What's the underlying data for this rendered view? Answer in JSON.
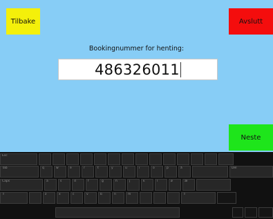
{
  "buttons": {
    "back": "Tilbake",
    "exit": "Avslutt",
    "next": "Neste"
  },
  "prompt": "Bookingnummer for henting:",
  "booking_field": {
    "value": "486326011"
  },
  "keyboard": {
    "rows": [
      [
        "Esc",
        "",
        "",
        "",
        "",
        "",
        "",
        "",
        "",
        "",
        "",
        "",
        "",
        "",
        ""
      ],
      [
        "Tab",
        "q",
        "w",
        "e",
        "r",
        "t",
        "y",
        "u",
        "i",
        "o",
        "p",
        "å",
        "",
        "Del"
      ],
      [
        "Caps",
        "a",
        "s",
        "d",
        "f",
        "g",
        "h",
        "j",
        "k",
        "l",
        "ø",
        "æ",
        ""
      ],
      [
        "⇧",
        "",
        "z",
        "x",
        "c",
        "v",
        "b",
        "n",
        "m",
        "",
        "",
        "",
        "⇧",
        ""
      ],
      [
        "",
        "",
        "",
        ""
      ]
    ]
  },
  "colors": {
    "background": "#87cdf6",
    "back_button": "#f4f00a",
    "exit_button": "#f40d0d",
    "next_button": "#1ee51b",
    "keyboard": "#111111"
  }
}
